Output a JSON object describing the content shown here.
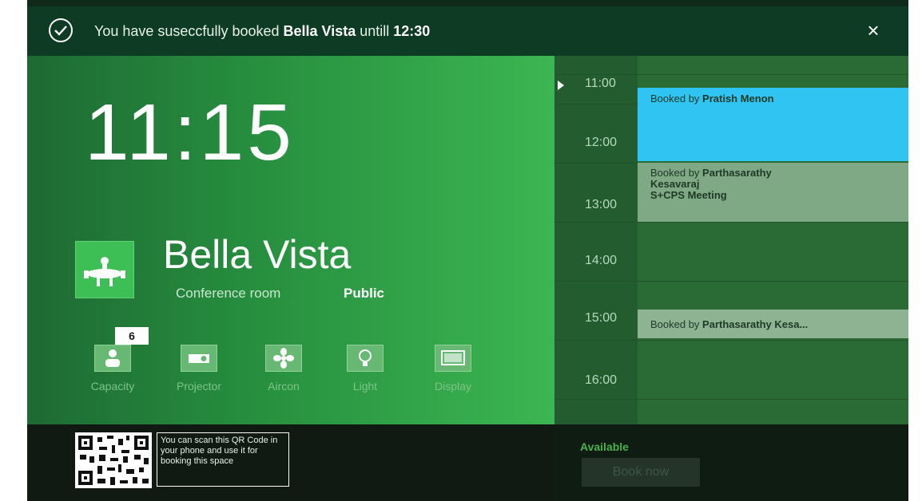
{
  "notification": {
    "prefix": "You have suseccfully booked ",
    "room": "Bella Vista",
    "middle": " untill ",
    "time": "12:30",
    "close_label": "×"
  },
  "clock": "11:15",
  "room": {
    "name": "Bella Vista",
    "type": "Conference room",
    "visibility": "Public"
  },
  "amenities": [
    {
      "label": "Capacity",
      "icon": "person-icon",
      "badge": "6"
    },
    {
      "label": "Projector",
      "icon": "projector-icon"
    },
    {
      "label": "Aircon",
      "icon": "fan-icon"
    },
    {
      "label": "Light",
      "icon": "bulb-icon"
    },
    {
      "label": "Display",
      "icon": "display-icon"
    }
  ],
  "schedule": {
    "hours": [
      "11:00",
      "12:00",
      "13:00",
      "14:00",
      "15:00",
      "16:00"
    ],
    "events": [
      {
        "prefix": "Booked by ",
        "name": "Pratish Menon",
        "subtitle": "",
        "color": "#2fc4f2"
      },
      {
        "prefix": "Booked by ",
        "name": "Parthasarathy",
        "name2": "Kesavaraj",
        "subtitle": "S+CPS Meeting",
        "color": "#7fa884"
      },
      {
        "prefix": "Booked by ",
        "name": "Parthasarathy Kesa...",
        "subtitle": "",
        "color": "#8eb393"
      }
    ]
  },
  "footer": {
    "qr_text": "You can scan this QR Code in your phone and use it for booking this space",
    "status": "Available",
    "book_label": "Book now"
  },
  "colors": {
    "accent_green": "#3cb652",
    "booked_blue": "#2fc4f2",
    "available_green": "#4caf50"
  }
}
